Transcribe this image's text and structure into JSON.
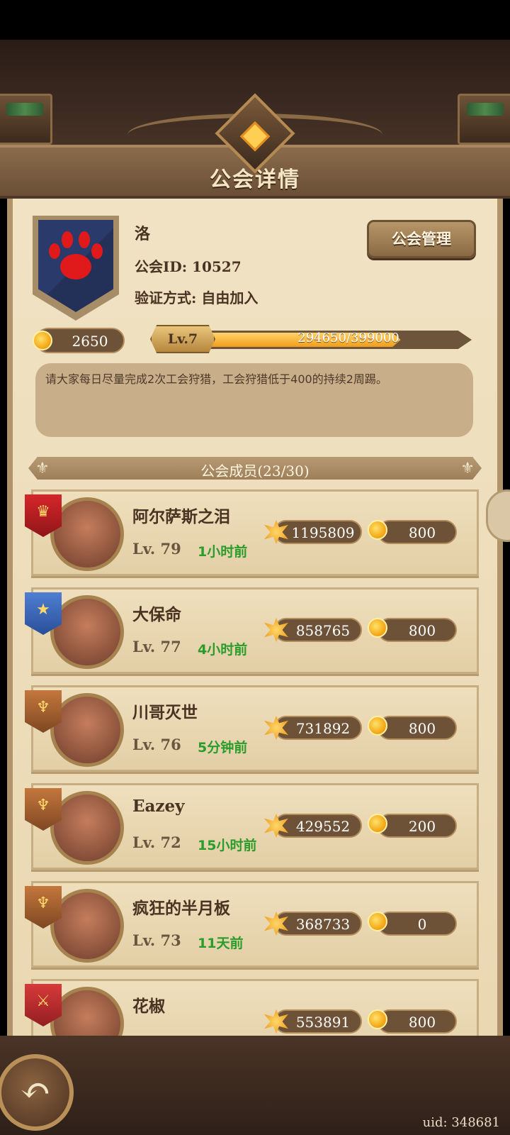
{
  "header": {
    "title": "公会详情"
  },
  "guild": {
    "name": "洛",
    "id_label": "公会ID: 10527",
    "verify_label": "验证方式: 自由加入",
    "manage_button": "公会管理",
    "gold": "2650",
    "level_badge": "Lv.7",
    "exp_text": "294650/399000",
    "exp_progress": 0.7385,
    "notice": "请大家每日尽量完成2次工会狩猎，工会狩猎低于400的持续2周踢。"
  },
  "members_header": "公会成员(23/30)",
  "members": [
    {
      "name": "阿尔萨斯之泪",
      "level": "Lv. 79",
      "last_online": "1小时前",
      "power": "1195809",
      "donation": "800",
      "rank": "gold"
    },
    {
      "name": "大保命",
      "level": "Lv. 77",
      "last_online": "4小时前",
      "power": "858765",
      "donation": "800",
      "rank": "blue"
    },
    {
      "name": "川哥灭世",
      "level": "Lv. 76",
      "last_online": "5分钟前",
      "power": "731892",
      "donation": "800",
      "rank": "bronze"
    },
    {
      "name": "Eazey",
      "level": "Lv. 72",
      "last_online": "15小时前",
      "power": "429552",
      "donation": "200",
      "rank": "bronze"
    },
    {
      "name": "疯狂的半月板",
      "level": "Lv. 73",
      "last_online": "11天前",
      "power": "368733",
      "donation": "0",
      "rank": "bronze"
    },
    {
      "name": "花椒",
      "level": "",
      "last_online": "",
      "power": "553891",
      "donation": "800",
      "rank": "red"
    }
  ],
  "footer": {
    "uid": "uid: 348681"
  },
  "icons": {
    "back": "back-arrow-icon",
    "coin": "gold-coin-icon",
    "power": "combat-power-icon"
  },
  "colors": {
    "accent": "#f29d1a",
    "online_text": "#2a9c2a",
    "panel": "#efdfbd"
  }
}
